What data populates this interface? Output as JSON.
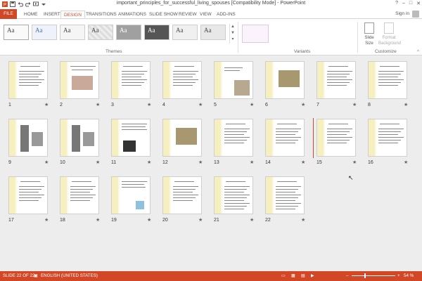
{
  "window": {
    "title": "important_principles_for_successful_living_spouses [Compatibility Mode] - PowerPoint",
    "controls": [
      "?",
      "–",
      "□",
      "✕"
    ]
  },
  "tabs": [
    "FILE",
    "HOME",
    "INSERT",
    "DESIGN",
    "TRANSITIONS",
    "ANIMATIONS",
    "SLIDE SHOW",
    "REVIEW",
    "VIEW",
    "ADD-INS"
  ],
  "active_tab": "DESIGN",
  "sign_in": "Sign in",
  "ribbon": {
    "themes_label": "Themes",
    "theme_sample": "Aa",
    "variants_label": "Variants",
    "customize_label": "Customize",
    "slide_size": "Slide Size",
    "format_background": "Format Background"
  },
  "slides": [
    {
      "num": "1",
      "star": "★"
    },
    {
      "num": "2",
      "star": "★"
    },
    {
      "num": "3",
      "star": "★"
    },
    {
      "num": "4",
      "star": "★"
    },
    {
      "num": "5",
      "star": "★"
    },
    {
      "num": "6",
      "star": "★"
    },
    {
      "num": "7",
      "star": "★"
    },
    {
      "num": "8",
      "star": "★"
    },
    {
      "num": "9",
      "star": "★"
    },
    {
      "num": "10",
      "star": "★"
    },
    {
      "num": "11",
      "star": "★"
    },
    {
      "num": "12",
      "star": "★"
    },
    {
      "num": "13",
      "star": "★"
    },
    {
      "num": "14",
      "star": "★"
    },
    {
      "num": "15",
      "star": "★"
    },
    {
      "num": "16",
      "star": "★"
    },
    {
      "num": "17",
      "star": "★"
    },
    {
      "num": "18",
      "star": "★"
    },
    {
      "num": "19",
      "star": "★"
    },
    {
      "num": "20",
      "star": "★"
    },
    {
      "num": "21",
      "star": "★"
    },
    {
      "num": "22",
      "star": "★"
    }
  ],
  "status": {
    "slide_info": "SLIDE 22 OF 22",
    "language": "ENGLISH (UNITED STATES)",
    "zoom": "54 %",
    "zoom_level": 0.54
  },
  "colors": {
    "accent": "#d24726",
    "slide_band": "#f6efc0"
  }
}
